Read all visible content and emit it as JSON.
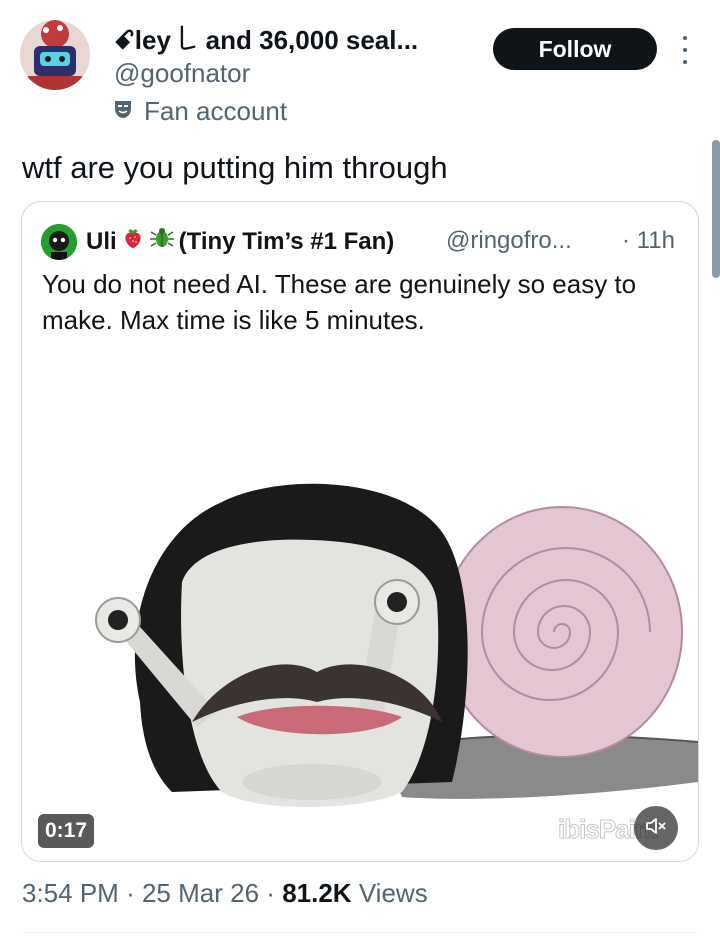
{
  "author": {
    "display_name": "ꗃley ꒒ and 36,000 seal...",
    "handle": "@goofnator",
    "label": "Fan account",
    "label_icon": "theater-mask-icon"
  },
  "actions": {
    "follow_label": "Follow",
    "more_icon": "more-vertical-icon"
  },
  "tweet": {
    "text": "wtf are you putting him through",
    "timestamp": "3:54 PM",
    "date": "25 Mar 26",
    "views_count": "81.2K",
    "views_label": "Views",
    "separator": "·"
  },
  "quote": {
    "name_start": "Uli",
    "name_end": "(Tiny Tim’s #1 Fan)",
    "emojis": [
      "strawberry-icon",
      "beetle-icon"
    ],
    "handle": "@ringofro...",
    "time": "· 11h",
    "text": "You do not need AI. These are genuinely so easy to make. Max time is like 5 minutes."
  },
  "video": {
    "duration": "0:17",
    "watermark": "ibisPaint",
    "mute_icon": "speaker-muted-icon"
  },
  "colors": {
    "text_primary": "#0f1419",
    "text_secondary": "#536471",
    "follow_bg": "#0f1419",
    "border": "#cfd9de"
  }
}
